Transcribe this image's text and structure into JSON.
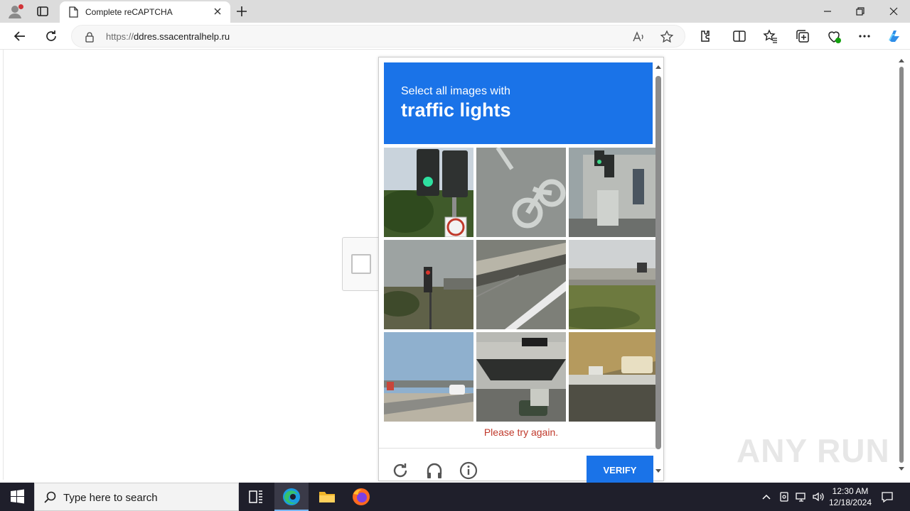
{
  "browser": {
    "tab_title": "Complete reCAPTCHA",
    "url_protocol": "https://",
    "url_host": "ddres.ssacentralhelp.ru"
  },
  "captcha": {
    "instruction": "Select all images with",
    "object": "traffic lights",
    "error": "Please try again.",
    "verify_label": "VERIFY",
    "tiles": [
      "traffic-signal-tile",
      "bike-lane-tile",
      "building-signal-tile",
      "red-signal-tile",
      "road-barrier-tile",
      "roadside-grass-tile",
      "highway-overpass-tile",
      "intersection-tile",
      "school-bus-tile"
    ]
  },
  "watermark": "ANY RUN",
  "taskbar": {
    "search_placeholder": "Type here to search",
    "time": "12:30 AM",
    "date": "12/18/2024"
  },
  "colors": {
    "accent": "#1a73e8",
    "error": "#c0392b",
    "taskbar": "#1f1f2b"
  }
}
